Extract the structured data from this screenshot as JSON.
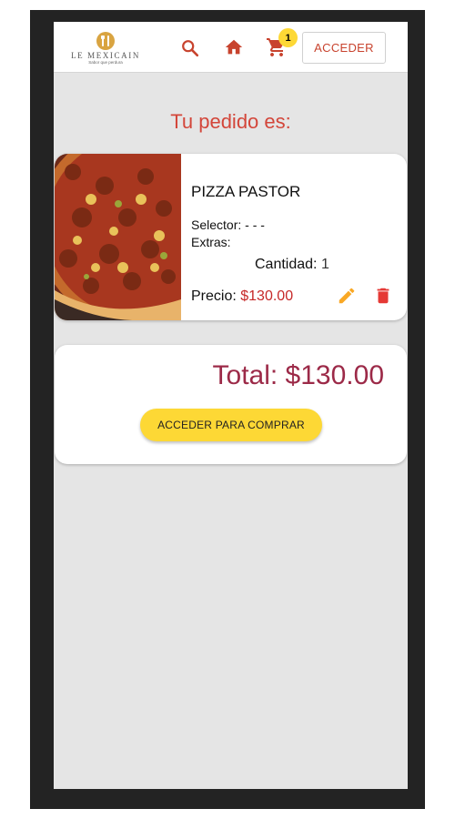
{
  "brand": {
    "name": "LE MEXICAIN",
    "tagline": "Sabor que perdura"
  },
  "header": {
    "icons": [
      "search-icon",
      "home-icon",
      "cart-icon"
    ],
    "cart_count": "1",
    "login_label": "ACCEDER"
  },
  "order": {
    "title": "Tu pedido es:",
    "item": {
      "name": "PIZZA PASTOR",
      "selector_label": "Selector:",
      "selector_value": " - - -",
      "extras_label": "Extras:",
      "quantity_label": "Cantidad:",
      "quantity_value": "1",
      "price_label": "Precio:",
      "price_value": "$130.00"
    }
  },
  "summary": {
    "total_text": "Total: $130.00",
    "buy_button": "ACCEDER PARA COMPRAR"
  },
  "colors": {
    "accent_red": "#d3463a",
    "price_red": "#c62828",
    "total_maroon": "#9c2a48",
    "yellow": "#fdd835",
    "edit_orange": "#f9a825",
    "delete_red": "#e53935",
    "background": "#e5e5e5"
  }
}
